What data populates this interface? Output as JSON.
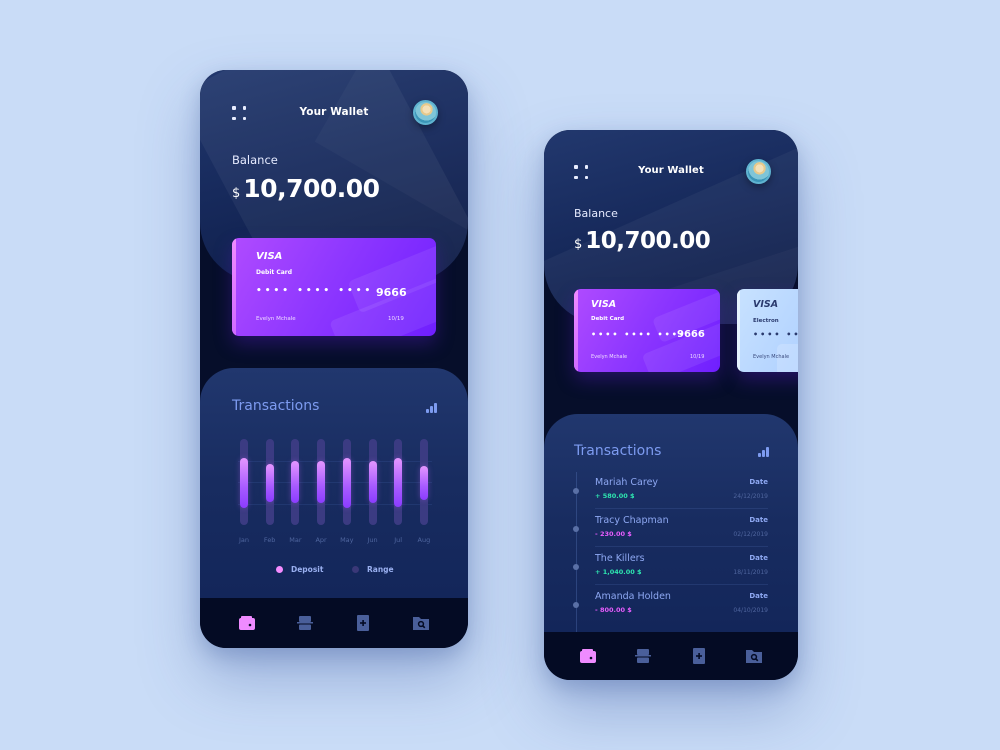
{
  "colors": {
    "background": "#c9dcf7",
    "phone_bg": "#060e2a",
    "accent_purple": "#8f38ff",
    "deposit": "#e496ff",
    "range": "#3b3b82",
    "positive": "#2ee6b0",
    "negative": "#e85dff",
    "nav_active": "#ef8bff",
    "nav_inactive": "#4a5f9a"
  },
  "screen1": {
    "header": {
      "title": "Your Wallet",
      "menu_icon": "grid-menu-icon",
      "avatar_icon": "user-avatar"
    },
    "balance": {
      "label": "Balance",
      "currency": "$",
      "amount": "10,700.00"
    },
    "card": {
      "brand": "VISA",
      "type": "Debit Card",
      "masked": "•••• •••• ••••",
      "last4": "9666",
      "holder": "Evelyn Mchale",
      "expiry": "10/19"
    },
    "transactions": {
      "title": "Transactions",
      "stats_icon": "bar-chart-icon"
    },
    "legend": [
      {
        "label": "Deposit",
        "color": "#f48cff"
      },
      {
        "label": "Range",
        "color": "#3a3878"
      }
    ],
    "nav": [
      {
        "name": "wallet",
        "icon": "wallet-icon",
        "active": true
      },
      {
        "name": "cards",
        "icon": "card-stack-icon",
        "active": false
      },
      {
        "name": "add",
        "icon": "add-document-icon",
        "active": false
      },
      {
        "name": "search",
        "icon": "folder-search-icon",
        "active": false
      }
    ]
  },
  "chart_data": {
    "type": "bar",
    "title": "Transactions",
    "categories": [
      "Jan",
      "Feb",
      "Mar",
      "Apr",
      "May",
      "Jun",
      "Jul",
      "Aug"
    ],
    "series": [
      {
        "name": "Range",
        "low": [
          0,
          0,
          0,
          0,
          0,
          0,
          0,
          0
        ],
        "high": [
          1,
          1,
          1,
          1,
          1,
          1,
          1,
          1
        ]
      },
      {
        "name": "Deposit",
        "low": [
          0.2,
          0.27,
          0.25,
          0.25,
          0.2,
          0.25,
          0.21,
          0.29
        ],
        "high": [
          0.78,
          0.71,
          0.74,
          0.74,
          0.78,
          0.74,
          0.78,
          0.69
        ]
      }
    ],
    "xlabel": "",
    "ylabel": "",
    "ylim": [
      0,
      1
    ],
    "grid": true,
    "legend_position": "bottom"
  },
  "screen2": {
    "header": {
      "title": "Your Wallet",
      "menu_icon": "grid-menu-icon",
      "avatar_icon": "user-avatar"
    },
    "balance": {
      "label": "Balance",
      "currency": "$",
      "amount": "10,700.00"
    },
    "cards": [
      {
        "brand": "VISA",
        "type": "Debit Card",
        "masked": "•••• •••• ••••",
        "last4": "9666",
        "holder": "Evelyn Mchale",
        "expiry": "10/19"
      },
      {
        "brand": "VISA",
        "type": "Electron",
        "masked": "•••• ••••",
        "holder": "Evelyn Mchale"
      }
    ],
    "transactions": {
      "title": "Transactions",
      "stats_icon": "bar-chart-icon",
      "date_label": "Date",
      "items": [
        {
          "name": "Mariah Carey",
          "amount": "+ 580.00 $",
          "type": "credit",
          "date": "24/12/2019"
        },
        {
          "name": "Tracy Chapman",
          "amount": "- 230.00 $",
          "type": "debit",
          "date": "02/12/2019"
        },
        {
          "name": "The Killers",
          "amount": "+ 1,040.00 $",
          "type": "credit",
          "date": "18/11/2019"
        },
        {
          "name": "Amanda Holden",
          "amount": "- 800.00 $",
          "type": "debit",
          "date": "04/10/2019"
        }
      ]
    },
    "nav": [
      {
        "name": "wallet",
        "icon": "wallet-icon",
        "active": true
      },
      {
        "name": "cards",
        "icon": "card-stack-icon",
        "active": false
      },
      {
        "name": "add",
        "icon": "add-document-icon",
        "active": false
      },
      {
        "name": "search",
        "icon": "folder-search-icon",
        "active": false
      }
    ]
  }
}
